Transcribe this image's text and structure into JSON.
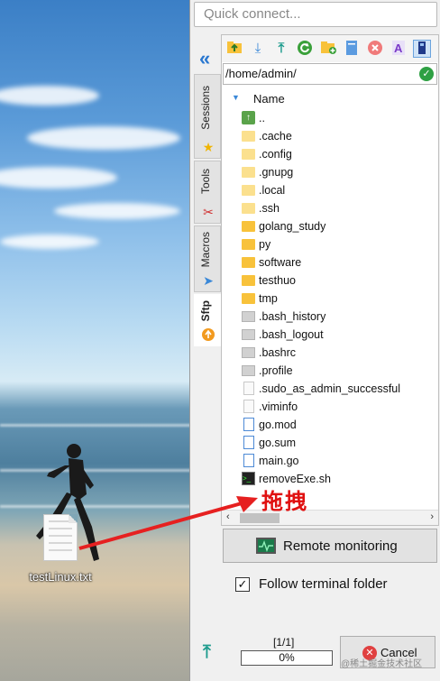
{
  "quick_connect": {
    "placeholder": "Quick connect..."
  },
  "sidebar": {
    "tabs": [
      {
        "label": "Sessions",
        "icon": "star-icon"
      },
      {
        "label": "Tools",
        "icon": "tools-icon"
      },
      {
        "label": "Macros",
        "icon": "paper-plane-icon"
      },
      {
        "label": "Sftp",
        "icon": "sftp-icon",
        "active": true
      }
    ]
  },
  "toolbar": {
    "icons": [
      "parent-folder-icon",
      "download-icon",
      "upload-icon",
      "refresh-icon",
      "new-folder-icon",
      "new-file-icon",
      "delete-icon",
      "rename-icon",
      "toggle-hidden-icon"
    ]
  },
  "sftp": {
    "path": "/home/admin/",
    "column_name": "Name",
    "files": [
      {
        "name": "..",
        "type": "up"
      },
      {
        "name": ".cache",
        "type": "folder-hidden"
      },
      {
        "name": ".config",
        "type": "folder-hidden"
      },
      {
        "name": ".gnupg",
        "type": "folder-hidden"
      },
      {
        "name": ".local",
        "type": "folder-hidden"
      },
      {
        "name": ".ssh",
        "type": "folder-hidden"
      },
      {
        "name": "golang_study",
        "type": "folder"
      },
      {
        "name": "py",
        "type": "folder"
      },
      {
        "name": "software",
        "type": "folder"
      },
      {
        "name": "testhuo",
        "type": "folder"
      },
      {
        "name": "tmp",
        "type": "folder"
      },
      {
        "name": ".bash_history",
        "type": "hidden-file"
      },
      {
        "name": ".bash_logout",
        "type": "hidden-file"
      },
      {
        "name": ".bashrc",
        "type": "hidden-file"
      },
      {
        "name": ".profile",
        "type": "hidden-file"
      },
      {
        "name": ".sudo_as_admin_successful",
        "type": "blank"
      },
      {
        "name": ".viminfo",
        "type": "blank"
      },
      {
        "name": "go.mod",
        "type": "doc"
      },
      {
        "name": "go.sum",
        "type": "doc"
      },
      {
        "name": "main.go",
        "type": "doc"
      },
      {
        "name": "removeExe.sh",
        "type": "script"
      }
    ]
  },
  "remote_monitoring": {
    "label": "Remote monitoring"
  },
  "follow_terminal": {
    "label": "Follow terminal folder",
    "checked": true
  },
  "transfer": {
    "count": "[1/1]",
    "progress_text": "0%",
    "progress": 0,
    "cancel_label": "Cancel"
  },
  "desktop": {
    "file_name": "testLinux.txt"
  },
  "annotation": {
    "text": "拖拽",
    "color": "#e01010"
  },
  "watermark": "@稀土掘金技术社区"
}
